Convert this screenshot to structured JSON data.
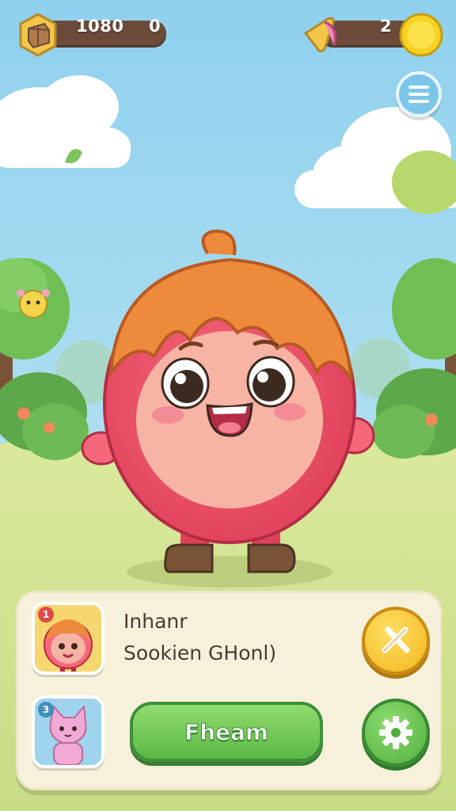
{
  "hud": {
    "left_resource": {
      "icon": "wood-crate-icon",
      "value": "1080",
      "extra": "0"
    },
    "right_resource": {
      "icon": "horn-icon",
      "value": "2",
      "coin_icon": "gold-coin-icon"
    }
  },
  "menu": {
    "icon": "menu-icon"
  },
  "panel": {
    "title": "Inhanr",
    "subtitle": "Sookien GHonl)",
    "portrait_1": {
      "icon": "orange-hero-portrait-icon",
      "badge": "1"
    },
    "portrait_2": {
      "icon": "pink-cat-portrait-icon",
      "badge": "3"
    },
    "primary_button_label": "Fheam",
    "top_round_button_icon": "crossed-tools-icon",
    "bottom_round_button_icon": "gear-icon"
  },
  "colors": {
    "sky": "#a9dcef",
    "grass": "#d8e79a",
    "panel": "#f7f1dc",
    "green_button": "#5db845",
    "yellow_button": "#f7c531",
    "hud_bar": "#6b4a3a"
  }
}
